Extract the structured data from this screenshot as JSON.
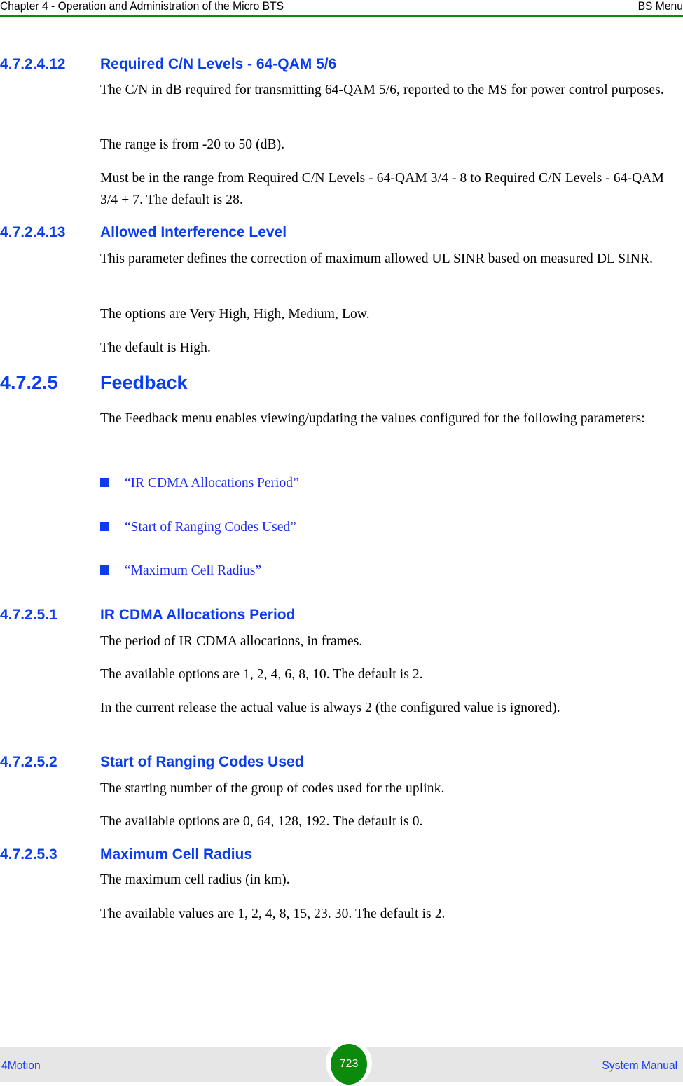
{
  "header": {
    "chapter": "Chapter 4 - Operation and Administration of the Micro BTS",
    "section": "BS Menu"
  },
  "sections": [
    {
      "number": "4.7.2.4.12",
      "title": "Required C/N Levels - 64-QAM 5/6",
      "paragraphs": [
        "The C/N in dB required for transmitting 64-QAM 5/6, reported to the MS for power control purposes.",
        "The range is from -20 to 50 (dB).",
        "Must be in the range from Required C/N Levels - 64-QAM 3/4 - 8 to Required C/N Levels - 64-QAM 3/4 + 7. The default is 28."
      ]
    },
    {
      "number": "4.7.2.4.13",
      "title": "Allowed Interference Level",
      "paragraphs": [
        "This parameter defines the correction of maximum allowed UL SINR based on measured DL SINR.",
        "The options are Very High, High, Medium, Low.",
        "The default is High."
      ]
    },
    {
      "number": "4.7.2.5",
      "title": "Feedback",
      "paragraphs": [
        "The Feedback menu enables viewing/updating the values configured for the following parameters:"
      ],
      "links": [
        "“IR CDMA Allocations Period”",
        "“Start of Ranging Codes Used”",
        "“Maximum Cell Radius”"
      ]
    },
    {
      "number": "4.7.2.5.1",
      "title": "IR CDMA Allocations Period",
      "paragraphs": [
        "The period of IR CDMA allocations, in frames.",
        "The available options are 1, 2, 4, 6, 8, 10. The default is 2.",
        "In the current release the actual value is always 2 (the configured value is ignored)."
      ]
    },
    {
      "number": "4.7.2.5.2",
      "title": "Start of Ranging Codes Used",
      "paragraphs": [
        "The starting number of the group of codes used for the uplink.",
        "The available options are 0, 64, 128, 192. The default is 0."
      ]
    },
    {
      "number": "4.7.2.5.3",
      "title": "Maximum Cell Radius",
      "paragraphs": [
        "The maximum cell radius (in km).",
        "The available values are 1, 2, 4, 8, 15, 23. 30. The default is 2."
      ]
    }
  ],
  "footer": {
    "product": "4Motion",
    "page_number": "723",
    "manual": "System Manual"
  }
}
